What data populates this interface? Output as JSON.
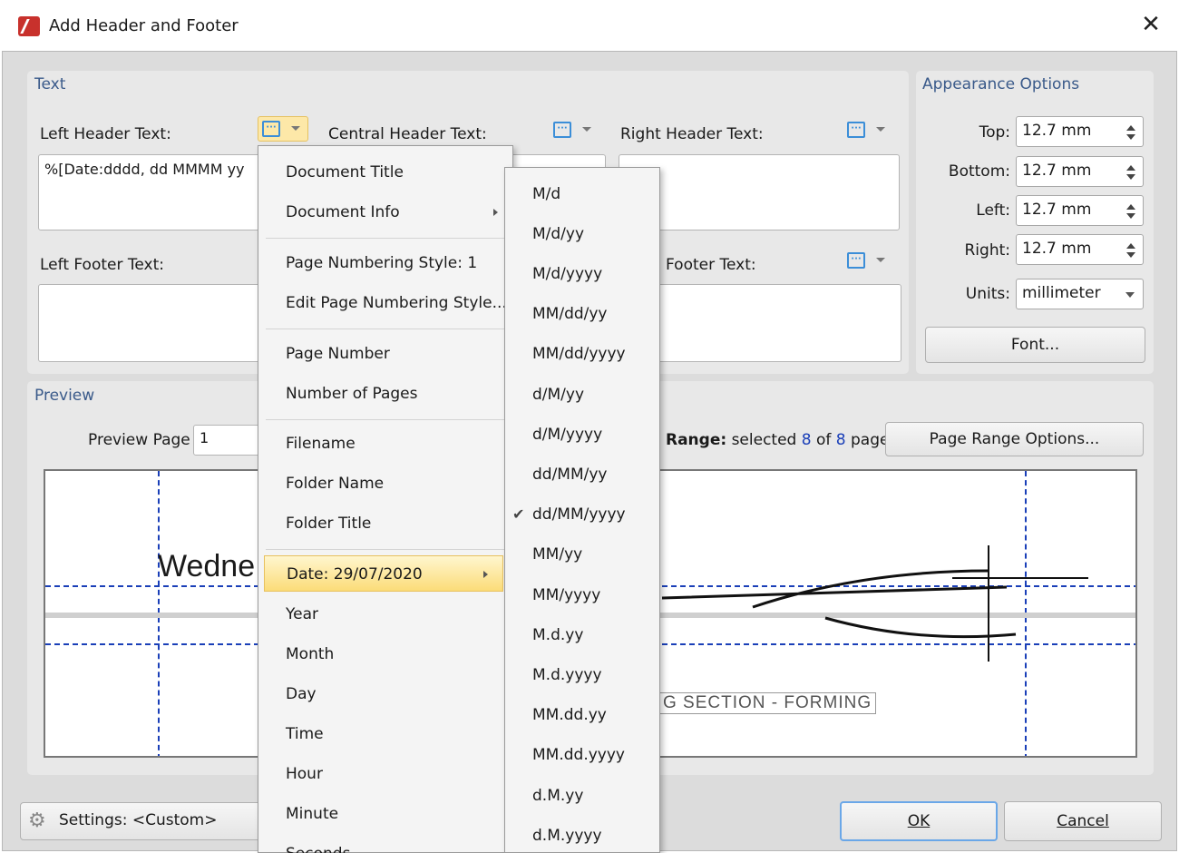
{
  "window": {
    "title": "Add Header and Footer",
    "close_glyph": "✕"
  },
  "text_group": {
    "title": "Text",
    "left_header_label": "Left Header Text:",
    "left_header_value": "%[Date:dddd, dd MMMM yy",
    "central_header_label": "Central Header Text:",
    "right_header_label": "Right Header Text:",
    "left_footer_label": "Left Footer Text:",
    "right_footer_label": "Footer Text:",
    "macro_glyph": "[···]"
  },
  "appearance": {
    "title": "Appearance Options",
    "top_label": "Top:",
    "top_value": "12.7 mm",
    "bottom_label": "Bottom:",
    "bottom_value": "12.7 mm",
    "left_label": "Left:",
    "left_value": "12.7 mm",
    "right_label": "Right:",
    "right_value": "12.7 mm",
    "units_label": "Units:",
    "units_value": "millimeter",
    "font_button": "Font..."
  },
  "preview": {
    "title": "Preview",
    "page_label": "Preview Page",
    "page_value": "1",
    "range_prefix": "Range:",
    "range_text": " selected ",
    "range_selected": "8",
    "range_of": " of ",
    "range_total": "8",
    "range_suffix": " pages",
    "range_button": "Page Range Options...",
    "sample_text": "Wedne",
    "drawing_text": "G SECTION - FORMING"
  },
  "footer": {
    "settings_label": "Settings: <Custom>",
    "ok_button": "OK",
    "cancel_button": "Cancel"
  },
  "macro_menu": {
    "items": [
      {
        "label": "Document Title"
      },
      {
        "label": "Document Info",
        "submenu": true
      },
      {
        "label": "Page Numbering Style: 1"
      },
      {
        "label": "Edit Page Numbering Style..."
      },
      {
        "label": "Page Number"
      },
      {
        "label": "Number of Pages"
      },
      {
        "label": "Filename"
      },
      {
        "label": "Folder Name"
      },
      {
        "label": "Folder Title"
      },
      {
        "label": "Date: 29/07/2020",
        "submenu": true,
        "highlighted": true
      },
      {
        "label": "Year"
      },
      {
        "label": "Month"
      },
      {
        "label": "Day"
      },
      {
        "label": "Time"
      },
      {
        "label": "Hour"
      },
      {
        "label": "Minute"
      },
      {
        "label": "Seconds"
      }
    ]
  },
  "date_submenu": {
    "items": [
      "M/d",
      "M/d/yy",
      "M/d/yyyy",
      "MM/dd/yy",
      "MM/dd/yyyy",
      "d/M/yy",
      "d/M/yyyy",
      "dd/MM/yy",
      "dd/MM/yyyy",
      "MM/yy",
      "MM/yyyy",
      "M.d.yy",
      "M.d.yyyy",
      "MM.dd.yy",
      "MM.dd.yyyy",
      "d.M.yy",
      "d.M.yyyy"
    ],
    "checked": "dd/MM/yyyy",
    "check_glyph": "✔"
  },
  "colors": {
    "accent": "#3a5a8a",
    "guide": "#1a3fb8",
    "highlight": "#fbdc78"
  }
}
